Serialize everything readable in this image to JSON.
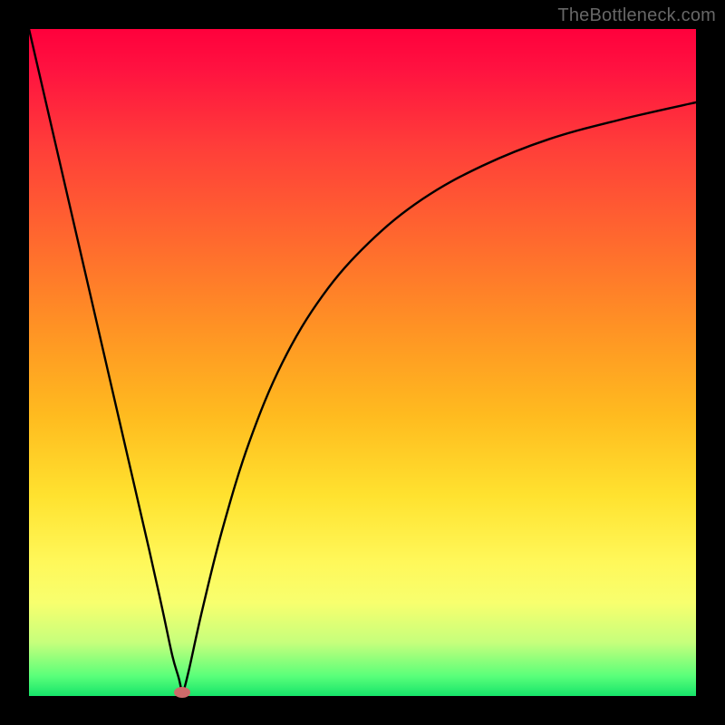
{
  "watermark": "TheBottleneck.com",
  "colors": {
    "curve_stroke": "#000000",
    "marker_fill": "#cd6a6a",
    "frame": "#000000"
  },
  "chart_data": {
    "type": "line",
    "title": "",
    "xlabel": "",
    "ylabel": "",
    "xlim": [
      0,
      100
    ],
    "ylim": [
      0,
      100
    ],
    "grid": false,
    "legend": false,
    "series": [
      {
        "name": "left-branch",
        "x": [
          0,
          3,
          6,
          9,
          12,
          15,
          18,
          20,
          21.5,
          22.5,
          23
        ],
        "y": [
          100,
          87,
          74,
          61,
          48,
          35,
          22,
          13,
          6,
          2.5,
          0
        ]
      },
      {
        "name": "right-branch",
        "x": [
          23,
          24,
          26,
          29,
          33,
          38,
          44,
          51,
          59,
          68,
          78,
          89,
          100
        ],
        "y": [
          0,
          4,
          13,
          25,
          38,
          50,
          60,
          68,
          74.5,
          79.5,
          83.5,
          86.5,
          89
        ]
      }
    ],
    "annotations": [
      {
        "name": "cusp-marker",
        "x": 23,
        "y": 0
      }
    ],
    "background_gradient": {
      "direction": "vertical",
      "stops": [
        {
          "pos": 0.0,
          "color": "#ff003c"
        },
        {
          "pos": 0.45,
          "color": "#ff9324"
        },
        {
          "pos": 0.8,
          "color": "#fff85a"
        },
        {
          "pos": 1.0,
          "color": "#16e46a"
        }
      ]
    }
  }
}
